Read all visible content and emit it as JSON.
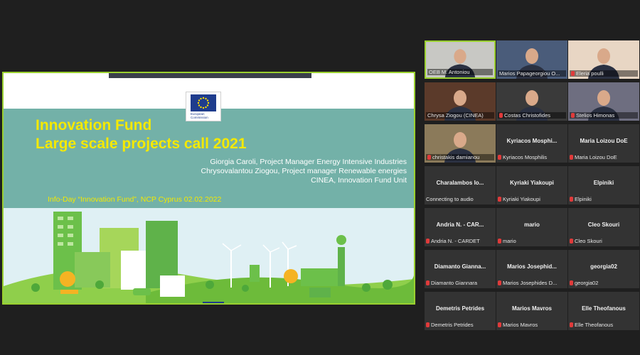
{
  "slide": {
    "ec_logo_line1": "European",
    "ec_logo_line2": "Commission",
    "title_line1": "Innovation Fund",
    "title_line2": "Large scale projects call 2021",
    "authors": [
      "Giorgia Caroli, Project Manager Energy Intensive Industries",
      "Chrysovalantou Ziogou, Project manager Renewable energies",
      "CINEA, Innovation Fund Unit"
    ],
    "info_day": "Info-Day “Innovation Fund”, NCP Cyprus 02.02.2022",
    "colors": {
      "title": "#f4e900",
      "background": "#73b1a8",
      "active_border": "#9ad02f"
    }
  },
  "participants": [
    {
      "display": "",
      "label": "OEB M. Antoniou",
      "video": true,
      "active": true,
      "muted": false
    },
    {
      "display": "",
      "label": "Marios Papageorgiou O...",
      "video": true,
      "active": false,
      "muted": false
    },
    {
      "display": "",
      "label": "Eleria poulli",
      "video": true,
      "active": false,
      "muted": true
    },
    {
      "display": "",
      "label": "Chrysa Ziogou (CINEA)",
      "video": true,
      "active": false,
      "muted": false
    },
    {
      "display": "",
      "label": "Costas Christofides",
      "video": true,
      "active": false,
      "muted": true
    },
    {
      "display": "",
      "label": "Stelios Himonas",
      "video": true,
      "active": false,
      "muted": true
    },
    {
      "display": "",
      "label": "christakis damianou",
      "video": true,
      "active": false,
      "muted": true
    },
    {
      "display": "Kyriacos Mosphi...",
      "label": "Kyriacos Mosphilis",
      "video": false,
      "active": false,
      "muted": true
    },
    {
      "display": "Maria Loizou DoE",
      "label": "Maria Loizou DoE",
      "video": false,
      "active": false,
      "muted": true
    },
    {
      "display": "Charalambos Io...",
      "label": "Connecting to audio",
      "video": false,
      "active": false,
      "muted": false
    },
    {
      "display": "Kyriaki Yiakoupi",
      "label": "Kyriaki Yiakoupi",
      "video": false,
      "active": false,
      "muted": true
    },
    {
      "display": "Elpiniki",
      "label": "Elpiniki",
      "video": false,
      "active": false,
      "muted": true
    },
    {
      "display": "Andria N. - CAR...",
      "label": "Andria N. - CARDET",
      "video": false,
      "active": false,
      "muted": true
    },
    {
      "display": "mario",
      "label": "mario",
      "video": false,
      "active": false,
      "muted": true
    },
    {
      "display": "Cleo Skouri",
      "label": "Cleo Skouri",
      "video": false,
      "active": false,
      "muted": true
    },
    {
      "display": "Diamanto Gianna...",
      "label": "Diamanto Giannara",
      "video": false,
      "active": false,
      "muted": true
    },
    {
      "display": "Marios Josephid...",
      "label": "Marios Josephides D...",
      "video": false,
      "active": false,
      "muted": true
    },
    {
      "display": "georgia02",
      "label": "georgia02",
      "video": false,
      "active": false,
      "muted": true
    },
    {
      "display": "Demetris Petrides",
      "label": "Demetris Petrides",
      "video": false,
      "active": false,
      "muted": true
    },
    {
      "display": "Marios Mavros",
      "label": "Marios Mavros",
      "video": false,
      "active": false,
      "muted": true
    },
    {
      "display": "Elle Theofanous",
      "label": "Elle Theofanous",
      "video": false,
      "active": false,
      "muted": true
    }
  ]
}
